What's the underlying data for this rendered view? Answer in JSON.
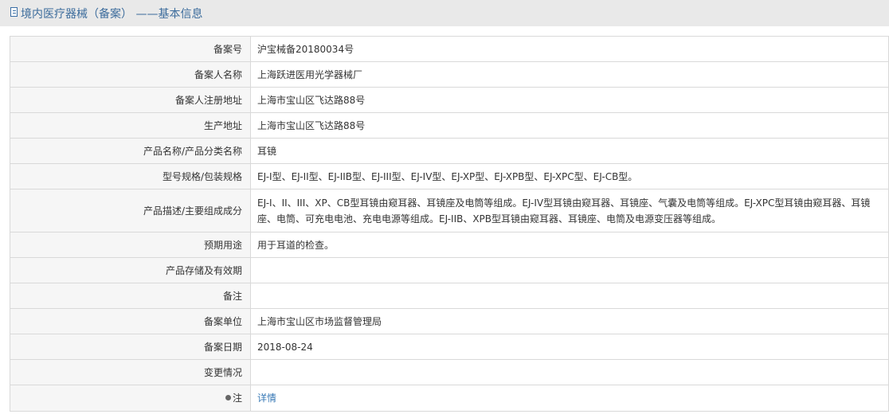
{
  "header": {
    "icon": "document-icon",
    "title": "境内医疗器械（备案） ——基本信息"
  },
  "rows": [
    {
      "label": "备案号",
      "value": "沪宝械备20180034号"
    },
    {
      "label": "备案人名称",
      "value": "上海跃进医用光学器械厂"
    },
    {
      "label": "备案人注册地址",
      "value": "上海市宝山区飞达路88号"
    },
    {
      "label": "生产地址",
      "value": "上海市宝山区飞达路88号"
    },
    {
      "label": "产品名称/产品分类名称",
      "value": "耳镜"
    },
    {
      "label": "型号规格/包装规格",
      "value": "EJ-I型、EJ-II型、EJ-IIB型、EJ-III型、EJ-IV型、EJ-XP型、EJ-XPB型、EJ-XPC型、EJ-CB型。"
    },
    {
      "label": "产品描述/主要组成成分",
      "value": "EJ-I、II、III、XP、CB型耳镜由窥耳器、耳镜座及电筒等组成。EJ-IV型耳镜由窥耳器、耳镜座、气囊及电筒等组成。EJ-XPC型耳镜由窥耳器、耳镜座、电筒、可充电电池、充电电源等组成。EJ-IIB、XPB型耳镜由窥耳器、耳镜座、电筒及电源变压器等组成。"
    },
    {
      "label": "预期用途",
      "value": "用于耳道的检查。"
    },
    {
      "label": "产品存储及有效期",
      "value": ""
    },
    {
      "label": "备注",
      "value": ""
    },
    {
      "label": "备案单位",
      "value": "上海市宝山区市场监督管理局"
    },
    {
      "label": "备案日期",
      "value": "2018-08-24"
    },
    {
      "label": "变更情况",
      "value": ""
    }
  ],
  "note_row": {
    "icon": "pin-icon",
    "label": "注",
    "link_text": "详情"
  }
}
